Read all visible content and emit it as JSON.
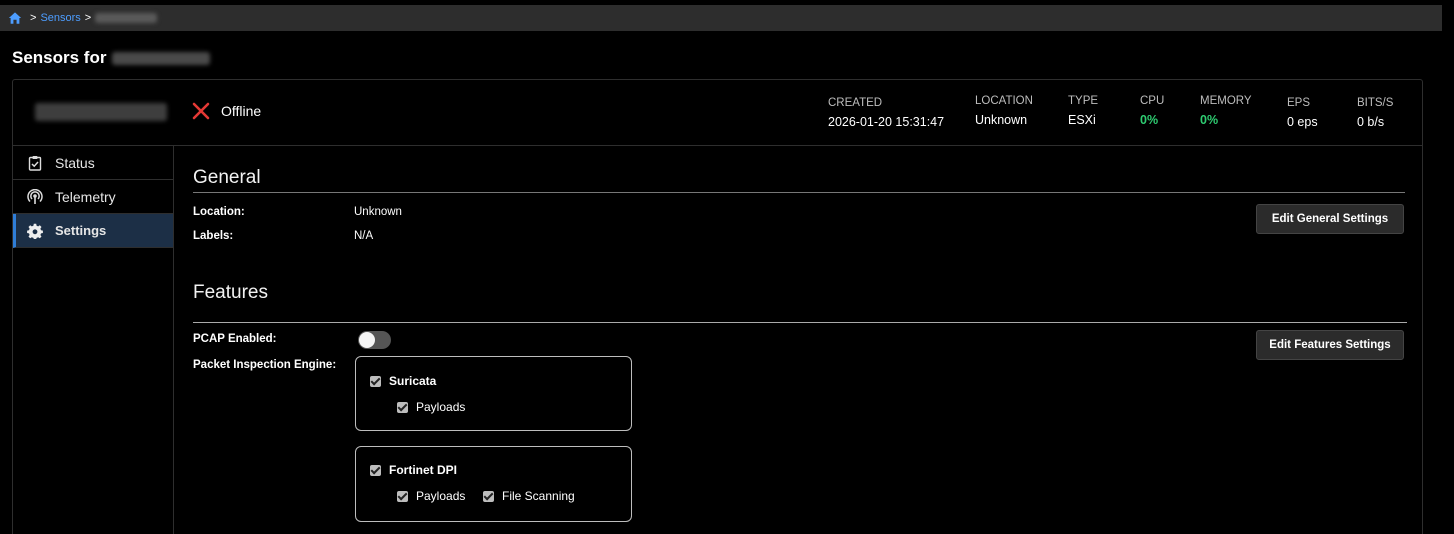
{
  "breadcrumb": {
    "sensors_label": "Sensors",
    "separator": ">"
  },
  "page": {
    "title_prefix": "Sensors for"
  },
  "sensor": {
    "status_text": "Offline",
    "metrics": [
      {
        "label": "CREATED",
        "value": "2026-01-20 15:31:47",
        "highlight": false
      },
      {
        "label": "LOCATION",
        "value": "Unknown",
        "highlight": false
      },
      {
        "label": "TYPE",
        "value": "ESXi",
        "highlight": false
      },
      {
        "label": "CPU",
        "value": "0%",
        "highlight": true
      },
      {
        "label": "MEMORY",
        "value": "0%",
        "highlight": true
      },
      {
        "label": "EPS",
        "value": "0 eps",
        "highlight": false
      },
      {
        "label": "BITS/S",
        "value": "0 b/s",
        "highlight": false
      }
    ]
  },
  "sidenav": {
    "items": [
      {
        "label": "Status",
        "icon": "clipboard-check-icon"
      },
      {
        "label": "Telemetry",
        "icon": "broadcast-icon"
      },
      {
        "label": "Settings",
        "icon": "gear-icon",
        "active": true
      }
    ]
  },
  "general": {
    "title": "General",
    "location_label": "Location:",
    "location_value": "Unknown",
    "labels_label": "Labels:",
    "labels_value": "N/A",
    "edit_button": "Edit General Settings"
  },
  "features": {
    "title": "Features",
    "pcap_label": "PCAP Enabled:",
    "pcap_enabled": false,
    "engine_label": "Packet Inspection Engine:",
    "edit_button": "Edit Features Settings",
    "engines": [
      {
        "name": "Suricata",
        "checked": true,
        "options": [
          {
            "label": "Payloads",
            "checked": true
          }
        ]
      },
      {
        "name": "Fortinet DPI",
        "checked": true,
        "options": [
          {
            "label": "Payloads",
            "checked": true
          },
          {
            "label": "File Scanning",
            "checked": true
          }
        ]
      }
    ]
  },
  "colors": {
    "accent": "#2f7ed8",
    "link": "#4d9dff",
    "ok": "#2ecc71",
    "error": "#e53935"
  }
}
